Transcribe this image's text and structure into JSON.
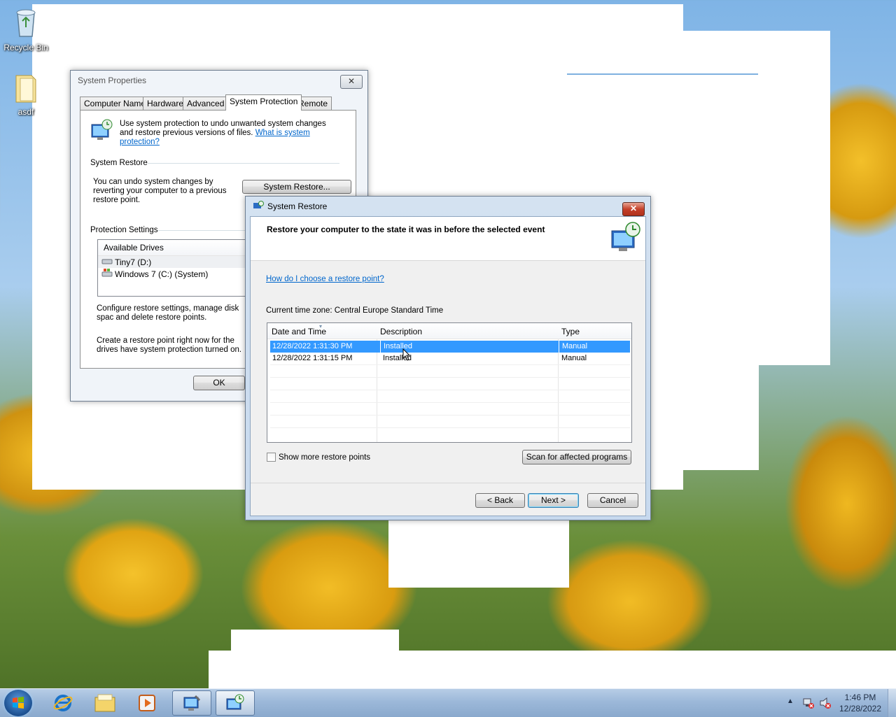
{
  "desktop": {
    "icons": [
      {
        "label": "Recycle Bin",
        "icon": "recycle-bin-icon"
      },
      {
        "label": "asdf",
        "icon": "folder-icon"
      }
    ]
  },
  "system_properties": {
    "title": "System Properties",
    "close_label": "✕",
    "tabs": [
      "Computer Name",
      "Hardware",
      "Advanced",
      "System Protection",
      "Remote"
    ],
    "active_tab": "System Protection",
    "intro_text": "Use system protection to undo unwanted system changes and restore previous versions of files.",
    "intro_link": "What is system protection?",
    "system_restore_heading": "System Restore",
    "system_restore_text": "You can undo system changes by reverting your computer to a previous restore point.",
    "system_restore_button": "System Restore...",
    "protection_heading": "Protection Settings",
    "drives_header": "Available Drives",
    "drives": [
      "Tiny7 (D:)",
      "Windows 7 (C:) (System)"
    ],
    "configure_text": "Configure restore settings, manage disk spac and delete restore points.",
    "create_text": "Create a restore point right now for the drives have system protection turned on.",
    "ok_button": "OK"
  },
  "system_restore": {
    "title": "System Restore",
    "close_label": "✕",
    "header_text": "Restore your computer to the state it was in before the selected event",
    "help_link": "How do I choose a restore point?",
    "timezone_text": "Current time zone: Central Europe Standard Time",
    "columns": [
      "Date and Time",
      "Description",
      "Type"
    ],
    "rows": [
      {
        "date": "12/28/2022 1:31:30 PM",
        "description": "Installed",
        "type": "Manual",
        "selected": true
      },
      {
        "date": "12/28/2022 1:31:15 PM",
        "description": "Installed",
        "type": "Manual",
        "selected": false
      }
    ],
    "show_more_label": "Show more restore points",
    "show_more_checked": false,
    "scan_button": "Scan for affected programs",
    "back_button": "< Back",
    "next_button": "Next >",
    "cancel_button": "Cancel"
  },
  "taskbar": {
    "start_icon": "windows-start-icon",
    "pinned": [
      "internet-explorer-icon",
      "file-explorer-icon",
      "media-player-icon",
      "system-properties-icon",
      "system-restore-icon"
    ],
    "clock_time": "1:46 PM",
    "clock_date": "12/28/2022",
    "accent": "#3399ff"
  }
}
